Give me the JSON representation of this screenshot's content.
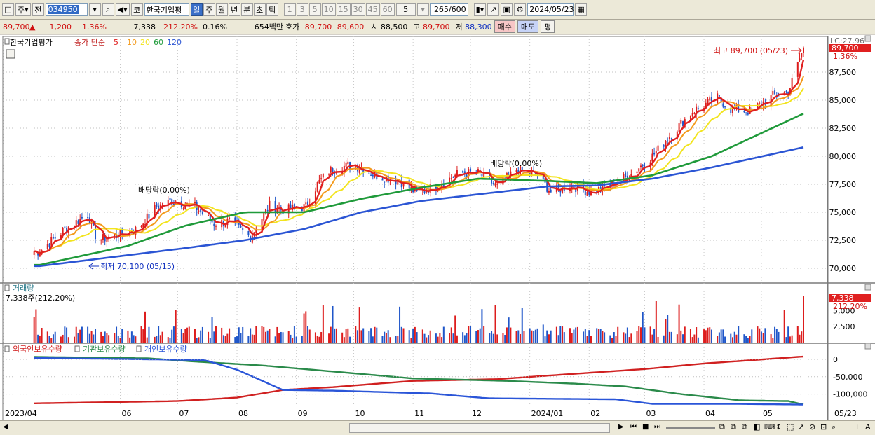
{
  "toolbar": {
    "type_label": "주",
    "prev_label": "전",
    "code": "034950",
    "name": "한국기업평",
    "market_label": "코",
    "periods": [
      "일",
      "주",
      "월",
      "년",
      "분",
      "초",
      "틱"
    ],
    "active_period": "일",
    "minutes": [
      "1",
      "3",
      "5",
      "10",
      "15",
      "30",
      "45",
      "60"
    ],
    "minute_value": "5",
    "count": "265",
    "count_max": "/600",
    "date": "2024/05/23"
  },
  "info": {
    "price": "89,700",
    "change_arrow": "▲",
    "change": "1,200",
    "change_pct": "+1.36%",
    "volume": "7,338",
    "vol_ratio": "212.20%",
    "turnover": "0.16%",
    "amount": "654백만",
    "quote_label": "호가",
    "ask": "89,700",
    "bid": "89,600",
    "open_label": "시",
    "open": "88,500",
    "high_label": "고",
    "high": "89,700",
    "low_label": "저",
    "low": "88,300",
    "buy_label": "매수",
    "sell_label": "매도",
    "avg_label": "평"
  },
  "panels": {
    "price_name": "한국기업평가",
    "ma_label": "종가 단순",
    "ma_periods": [
      "5",
      "10",
      "20",
      "60",
      "120"
    ],
    "max_label": "최고 89,700 (05/23)",
    "min_label": "최저 70,100 (05/15)",
    "dividend_labels": [
      "배당락(0.00%)",
      "배당락(0.00%)"
    ],
    "top_right_labels": [
      "LC:27.96",
      "89,700",
      "1.36%"
    ],
    "volume_title": "거래량",
    "volume_value": "7,338주(212.20%)",
    "volume_right": [
      "7,338",
      "212.20%"
    ],
    "holdings_titles": [
      "외국인보유수량",
      "기관보유수량",
      "개인보유수량"
    ]
  },
  "colors": {
    "up": "#dd1d1d",
    "down": "#1f56c9",
    "ma5": "#e02020",
    "ma10": "#f39a1c",
    "ma20": "#f2e41e",
    "ma60": "#1f9a3a",
    "ma120": "#2b55d4"
  },
  "chart_data": [
    {
      "type": "candlestick",
      "title": "한국기업평가",
      "x_start": "2023-04",
      "x_end": "2024-05-23",
      "x_ticks": [
        "2023/04",
        "06",
        "07",
        "08",
        "09",
        "10",
        "11",
        "12",
        "2024/01",
        "02",
        "03",
        "04",
        "05",
        "05/23"
      ],
      "y_ticks": [
        70000,
        72500,
        75000,
        77500,
        80000,
        82500,
        85000,
        87500
      ],
      "ylim": [
        68900,
        90800
      ],
      "close_keypoints": [
        [
          "2023-04-20",
          71500
        ],
        [
          "2023-05-03",
          73500
        ],
        [
          "2023-05-15",
          74800
        ],
        [
          "2023-05-20",
          72500
        ],
        [
          "2023-06-10",
          73500
        ],
        [
          "2023-06-20",
          75500
        ],
        [
          "2023-06-28",
          76000
        ],
        [
          "2023-07-10",
          75500
        ],
        [
          "2023-07-20",
          74000
        ],
        [
          "2023-07-28",
          74200
        ],
        [
          "2023-08-08",
          72800
        ],
        [
          "2023-08-18",
          75600
        ],
        [
          "2023-08-25",
          75200
        ],
        [
          "2023-09-06",
          75500
        ],
        [
          "2023-09-12",
          77500
        ],
        [
          "2023-09-18",
          78700
        ],
        [
          "2023-09-28",
          79200
        ],
        [
          "2023-10-05",
          79000
        ],
        [
          "2023-10-12",
          78300
        ],
        [
          "2023-10-25",
          77800
        ],
        [
          "2023-11-03",
          76700
        ],
        [
          "2023-11-15",
          77500
        ],
        [
          "2023-11-25",
          78500
        ],
        [
          "2023-12-05",
          78500
        ],
        [
          "2023-12-15",
          77300
        ],
        [
          "2023-12-25",
          78800
        ],
        [
          "2024-01-05",
          78300
        ],
        [
          "2024-01-12",
          76800
        ],
        [
          "2024-01-22",
          77400
        ],
        [
          "2024-02-02",
          76800
        ],
        [
          "2024-02-13",
          77500
        ],
        [
          "2024-02-22",
          78300
        ],
        [
          "2024-03-05",
          80000
        ],
        [
          "2024-03-15",
          82000
        ],
        [
          "2024-03-26",
          84000
        ],
        [
          "2024-04-08",
          85200
        ],
        [
          "2024-04-15",
          84200
        ],
        [
          "2024-04-25",
          84000
        ],
        [
          "2024-05-07",
          85400
        ],
        [
          "2024-05-15",
          85700
        ],
        [
          "2024-05-23",
          89700
        ]
      ],
      "ma60_keypoints": [
        [
          "2023-04-20",
          70300
        ],
        [
          "2023-06-05",
          72000
        ],
        [
          "2023-07-05",
          73800
        ],
        [
          "2023-08-05",
          75000
        ],
        [
          "2023-09-05",
          75000
        ],
        [
          "2023-10-05",
          76200
        ],
        [
          "2023-11-05",
          77200
        ],
        [
          "2023-12-05",
          78000
        ],
        [
          "2024-01-10",
          77800
        ],
        [
          "2024-02-05",
          77600
        ],
        [
          "2024-03-05",
          78300
        ],
        [
          "2024-04-05",
          80000
        ],
        [
          "2024-05-23",
          83800
        ]
      ],
      "ma120_keypoints": [
        [
          "2023-04-20",
          70200
        ],
        [
          "2023-07-05",
          71800
        ],
        [
          "2023-08-05",
          72500
        ],
        [
          "2023-09-05",
          73500
        ],
        [
          "2023-10-05",
          75000
        ],
        [
          "2023-11-05",
          76000
        ],
        [
          "2023-12-05",
          76600
        ],
        [
          "2024-01-10",
          77300
        ],
        [
          "2024-02-05",
          77400
        ],
        [
          "2024-03-05",
          78000
        ],
        [
          "2024-04-05",
          79000
        ],
        [
          "2024-05-23",
          80800
        ]
      ],
      "max": {
        "date": "2024-05-23",
        "value": 89700
      },
      "min": {
        "date": "2023-05-15",
        "value": 70100
      },
      "dividends": [
        "2023-06-25",
        "2023-12-26"
      ]
    },
    {
      "type": "bar",
      "title": "거래량",
      "y_ticks": [
        2500,
        5000
      ],
      "ylim": [
        0,
        7800
      ],
      "last": 7338
    },
    {
      "type": "line",
      "title": "보유수량",
      "series": [
        {
          "name": "외국인보유수량",
          "color": "#d02020"
        },
        {
          "name": "기관보유수량",
          "color": "#2a8a4a"
        },
        {
          "name": "개인보유수량",
          "color": "#2a55d8"
        }
      ],
      "y_ticks": [
        0,
        -50000,
        -100000
      ],
      "ylim": [
        -135000,
        18000
      ],
      "foreign": [
        [
          "2023-04-01",
          -128000
        ],
        [
          "2023-07-01",
          -120000
        ],
        [
          "2023-08-01",
          -110000
        ],
        [
          "2023-08-25",
          -88000
        ],
        [
          "2023-09-20",
          -80000
        ],
        [
          "2023-11-01",
          -62000
        ],
        [
          "2023-12-15",
          -57000
        ],
        [
          "2024-01-10",
          -47000
        ],
        [
          "2024-03-01",
          -28000
        ],
        [
          "2024-04-01",
          -12000
        ],
        [
          "2024-05-23",
          8000
        ]
      ],
      "institution": [
        [
          "2023-04-01",
          8000
        ],
        [
          "2023-06-15",
          3000
        ],
        [
          "2023-07-15",
          -8000
        ],
        [
          "2023-08-15",
          -18000
        ],
        [
          "2023-09-20",
          -35000
        ],
        [
          "2023-11-01",
          -55000
        ],
        [
          "2023-12-20",
          -62000
        ],
        [
          "2024-01-25",
          -70000
        ],
        [
          "2024-02-20",
          -78000
        ],
        [
          "2024-03-20",
          -100000
        ],
        [
          "2024-04-20",
          -118000
        ],
        [
          "2024-05-15",
          -120000
        ],
        [
          "2024-05-23",
          -130000
        ]
      ],
      "individual": [
        [
          "2023-04-01",
          5000
        ],
        [
          "2023-07-15",
          -2000
        ],
        [
          "2023-08-01",
          -30000
        ],
        [
          "2023-08-25",
          -88000
        ],
        [
          "2023-09-20",
          -90000
        ],
        [
          "2023-11-10",
          -98000
        ],
        [
          "2023-12-10",
          -112000
        ],
        [
          "2024-02-15",
          -115000
        ],
        [
          "2024-03-05",
          -128000
        ],
        [
          "2024-04-15",
          -128000
        ],
        [
          "2024-05-23",
          -130000
        ]
      ]
    }
  ]
}
